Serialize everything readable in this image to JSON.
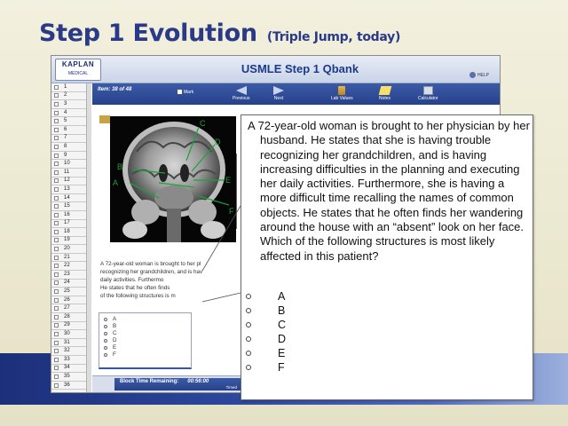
{
  "slide": {
    "title": "Step 1 Evolution",
    "subtitle": "(Triple Jump, today)"
  },
  "window": {
    "logo_text": "KAPLAN",
    "logo_sub": "MEDICAL",
    "title": "USMLE Step 1 Qbank",
    "help_label": "HELP"
  },
  "toolbar": {
    "item_label": "Item: 38 of 48",
    "mark_label": "Mark",
    "previous_label": "Previous",
    "next_label": "Next",
    "lab_values_label": "Lab Values",
    "notes_label": "Notes",
    "calculator_label": "Calculator"
  },
  "sidebar": {
    "items": [
      "1",
      "2",
      "3",
      "4",
      "5",
      "6",
      "7",
      "8",
      "9",
      "10",
      "11",
      "12",
      "13",
      "14",
      "15",
      "16",
      "17",
      "18",
      "19",
      "20",
      "21",
      "22",
      "23",
      "24",
      "25",
      "26",
      "27",
      "28",
      "29",
      "30",
      "31",
      "32",
      "33",
      "34",
      "35",
      "36"
    ]
  },
  "image": {
    "labels": [
      "A",
      "B",
      "C",
      "D",
      "E",
      "F"
    ]
  },
  "question_preview_lines": [
    "A 72-year-old woman is brought to her pl",
    "recognizing her grandchildren, and is hav",
    "daily activities. Furthermo",
    "He states that he often finds",
    "of the following structures is m"
  ],
  "question": {
    "stem": "A 72-year-old woman is brought to her physician by her husband. He states that she is having trouble recognizing her grandchildren, and is having increasing difficulties in the planning and executing her daily activities. Furthermore, she is having a more difficult time recalling the names of common objects. He states that he often finds her wandering around the house with an “absent” look on her face. Which of the following structures is most likely affected in this patient?",
    "options": [
      "A",
      "B",
      "C",
      "D",
      "E",
      "F"
    ]
  },
  "footer": {
    "block_time_label": "Block Time Remaining:",
    "block_time_value": "00:56:00",
    "timed_label": "Timed"
  }
}
